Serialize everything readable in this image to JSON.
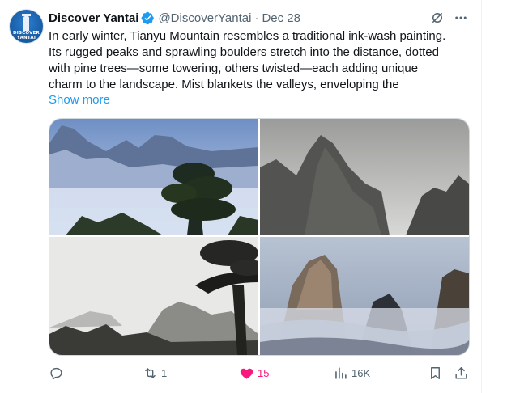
{
  "tweet": {
    "author_name": "Discover Yantai",
    "handle": "@DiscoverYantai",
    "separator": "·",
    "date": "Dec 28",
    "avatar_text": [
      "DISCOVER",
      "YANTAI"
    ],
    "text_lines": [
      "In early winter, Tianyu Mountain resembles a traditional ink-wash painting.",
      "Its rugged peaks and sprawling boulders stretch into the distance, dotted",
      "with pine trees—some towering, others twisted—each adding unique",
      "charm to the landscape. Mist blankets the valleys, enveloping the"
    ],
    "show_more": "Show more",
    "images": [
      {
        "subject": "misty blue mountain peaks with pine tree"
      },
      {
        "subject": "grey misty cliff ink-wash style"
      },
      {
        "subject": "monochrome peaks with twisted pine"
      },
      {
        "subject": "peaks above sea of clouds"
      }
    ],
    "actions": {
      "replies": "",
      "retweets": "1",
      "likes": "15",
      "views": "16K"
    },
    "colors": {
      "accent": "#1d9bf0",
      "like": "#f91880",
      "muted": "#536471"
    },
    "icons": [
      "verified-badge-icon",
      "grok-icon",
      "more-icon",
      "reply-icon",
      "retweet-icon",
      "heart-icon",
      "views-icon",
      "bookmark-icon",
      "share-icon"
    ]
  }
}
